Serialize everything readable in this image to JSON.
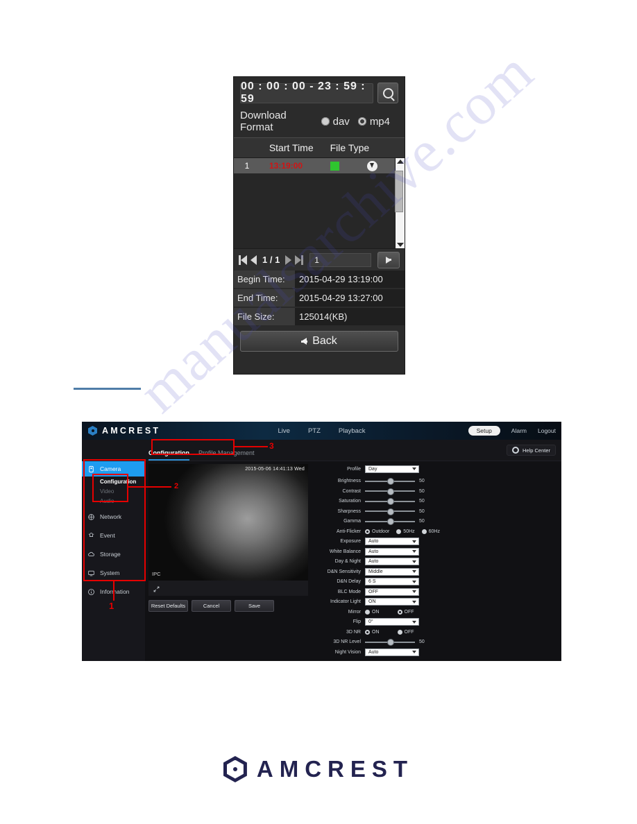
{
  "download_dialog": {
    "time_range": "00 : 00 : 00 - 23 : 59 : 59",
    "search_icon": "magnifier-icon",
    "download_format_label": "Download Format",
    "format_options": [
      {
        "label": "dav",
        "selected": false
      },
      {
        "label": "mp4",
        "selected": true
      }
    ],
    "columns": [
      "Start Time",
      "File Type"
    ],
    "rows": [
      {
        "index": "1",
        "start_time": "13:19:00",
        "file_type_color": "#2fc52f",
        "download_icon": "download-circle-icon"
      }
    ],
    "pager": {
      "first_icon": "first-page-icon",
      "prev_icon": "prev-page-icon",
      "page_count": "1 / 1",
      "next_icon": "next-page-icon",
      "last_icon": "last-page-icon",
      "page_input_value": "1",
      "go_icon": "go-arrow-icon"
    },
    "details": [
      {
        "label": "Begin Time:",
        "value": "2015-04-29 13:19:00"
      },
      {
        "label": "End Time:",
        "value": "2015-04-29 13:27:00"
      },
      {
        "label": "File Size:",
        "value": "125014(KB)"
      }
    ],
    "back_label": "Back",
    "back_icon": "arrow-left-icon"
  },
  "web_ui": {
    "brand": "AMCREST",
    "brand_icon": "amcrest-hex-icon",
    "nav": [
      "Live",
      "PTZ",
      "Playback"
    ],
    "actions": {
      "setup": "Setup",
      "alarm": "Alarm",
      "logout": "Logout"
    },
    "tabs": [
      {
        "label": "Configuration",
        "active": true
      },
      {
        "label": "Profile Management",
        "active": false
      }
    ],
    "help_center": "Help Center",
    "help_icon": "gear-icon",
    "sidebar": [
      {
        "label": "Camera",
        "icon": "camera-icon",
        "active": true,
        "children": [
          {
            "label": "Configuration",
            "selected": true
          },
          {
            "label": "Video",
            "selected": false
          },
          {
            "label": "Audio",
            "selected": false
          }
        ]
      },
      {
        "label": "Network",
        "icon": "network-icon",
        "active": false,
        "children": []
      },
      {
        "label": "Event",
        "icon": "event-bell-icon",
        "active": false,
        "children": []
      },
      {
        "label": "Storage",
        "icon": "storage-cloud-icon",
        "active": false,
        "children": []
      },
      {
        "label": "System",
        "icon": "system-monitor-icon",
        "active": false,
        "children": []
      },
      {
        "label": "Information",
        "icon": "info-icon",
        "active": false,
        "children": []
      }
    ],
    "video": {
      "timestamp": "2015-05-06 14:41:13 Wed",
      "channel_label": "IPC",
      "expand_icon": "expand-fullscreen-icon"
    },
    "buttons": [
      {
        "label": "Reset Defaults"
      },
      {
        "label": "Cancel"
      },
      {
        "label": "Save"
      }
    ],
    "settings": [
      {
        "label": "Profile",
        "type": "select",
        "value": "Day"
      },
      {
        "label": "Brightness",
        "type": "slider",
        "value": "50"
      },
      {
        "label": "Contrast",
        "type": "slider",
        "value": "50"
      },
      {
        "label": "Saturation",
        "type": "slider",
        "value": "50"
      },
      {
        "label": "Sharpness",
        "type": "slider",
        "value": "50"
      },
      {
        "label": "Gamma",
        "type": "slider",
        "value": "50"
      },
      {
        "label": "Anti-Flicker",
        "type": "radio3",
        "options": [
          "Outdoor",
          "50Hz",
          "60Hz"
        ],
        "selected": "Outdoor"
      },
      {
        "label": "Exposure",
        "type": "select",
        "value": "Auto"
      },
      {
        "label": "White Balance",
        "type": "select",
        "value": "Auto"
      },
      {
        "label": "Day & Night",
        "type": "select",
        "value": "Auto"
      },
      {
        "label": "D&N Sensitivity",
        "type": "select",
        "value": "Middle"
      },
      {
        "label": "D&N Delay",
        "type": "select",
        "value": "6 S"
      },
      {
        "label": "BLC Mode",
        "type": "select",
        "value": "OFF"
      },
      {
        "label": "Indicator Light",
        "type": "select",
        "value": "ON"
      },
      {
        "label": "Mirror",
        "type": "radio2",
        "options": [
          "ON",
          "OFF"
        ],
        "selected": "OFF"
      },
      {
        "label": "Flip",
        "type": "select",
        "value": "0°"
      },
      {
        "label": "3D NR",
        "type": "radio2",
        "options": [
          "ON",
          "OFF"
        ],
        "selected": "ON"
      },
      {
        "label": "3D NR Level",
        "type": "slider",
        "value": "50"
      },
      {
        "label": "Night Vision",
        "type": "select",
        "value": "Auto"
      }
    ]
  },
  "annotations": [
    {
      "number": "1"
    },
    {
      "number": "2"
    },
    {
      "number": "3"
    }
  ],
  "footer": {
    "logo_text": "AMCREST",
    "logo_icon": "amcrest-hex-icon"
  },
  "watermark": {
    "text": "manualsarchive.com"
  }
}
